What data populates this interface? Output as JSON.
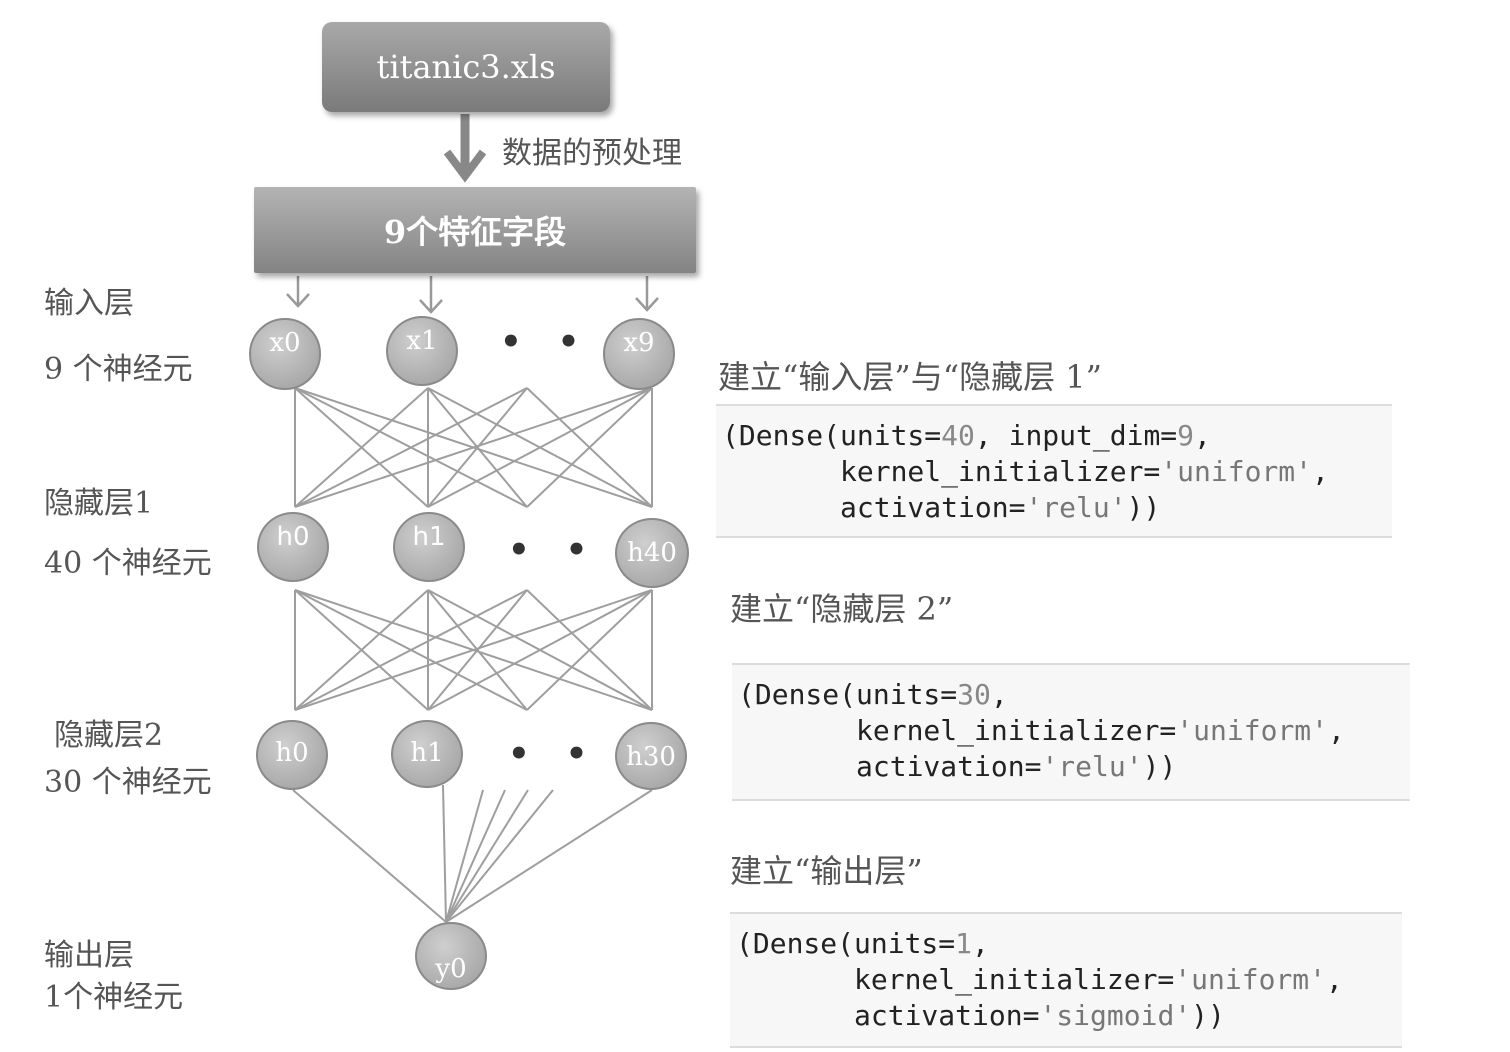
{
  "source": "titanic3.xls",
  "preprocess": "数据的预处理",
  "features": "9个特征字段",
  "layers": {
    "input": {
      "title": "输入层",
      "count": "9 个神经元",
      "nodes": [
        "x0",
        "x1",
        "x9"
      ]
    },
    "hidden1": {
      "title": "隐藏层1",
      "count": "40 个神经元",
      "nodes": [
        "h0",
        "h1",
        "h40"
      ]
    },
    "hidden2": {
      "title": "隐藏层2",
      "count": "30 个神经元",
      "nodes": [
        "h0",
        "h1",
        "h30"
      ]
    },
    "output": {
      "title": "输出层",
      "count": "1个神经元",
      "nodes": [
        "y0"
      ]
    }
  },
  "ellipsis": "• • •",
  "captions": {
    "c1": "建立“输入层”与“隐藏层 1”",
    "c2": "建立“隐藏层 2”",
    "c3": "建立“输出层”"
  },
  "code": {
    "b1": {
      "l1a": "(Dense(units=",
      "l1n": "40",
      "l1b": ", input_dim=",
      "l1n2": "9",
      "l1c": ",",
      "l2a": "       kernel_initializer=",
      "l2s": "'uniform'",
      "l2c": ",",
      "l3a": "       activation=",
      "l3s": "'relu'",
      "l3c": "))"
    },
    "b2": {
      "l1a": "(Dense(units=",
      "l1n": "30",
      "l1c": ",",
      "l2a": "       kernel_initializer=",
      "l2s": "'uniform'",
      "l2c": ",",
      "l3a": "       activation=",
      "l3s": "'relu'",
      "l3c": "))"
    },
    "b3": {
      "l1a": "(Dense(units=",
      "l1n": "1",
      "l1c": ",",
      "l2a": "       kernel_initializer=",
      "l2s": "'uniform'",
      "l2c": ",",
      "l3a": "       activation=",
      "l3s": "'sigmoid'",
      "l3c": "))"
    }
  }
}
